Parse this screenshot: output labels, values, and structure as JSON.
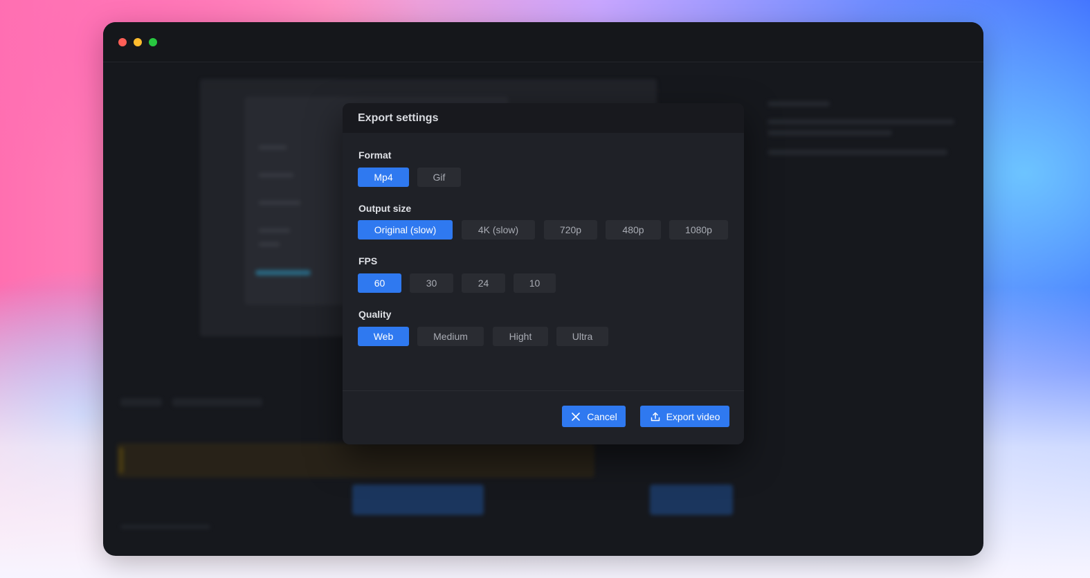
{
  "window": {
    "traffic_lights": [
      "close",
      "minimize",
      "zoom"
    ]
  },
  "dialog": {
    "title": "Export settings",
    "sections": {
      "format": {
        "label": "Format",
        "options": [
          "Mp4",
          "Gif"
        ],
        "selected": "Mp4"
      },
      "output_size": {
        "label": "Output size",
        "options": [
          "Original (slow)",
          "4K (slow)",
          "720p",
          "480p",
          "1080p"
        ],
        "selected": "Original (slow)"
      },
      "fps": {
        "label": "FPS",
        "options": [
          "60",
          "30",
          "24",
          "10"
        ],
        "selected": "60"
      },
      "quality": {
        "label": "Quality",
        "options": [
          "Web",
          "Medium",
          "Hight",
          "Ultra"
        ],
        "selected": "Web"
      }
    },
    "buttons": {
      "cancel": {
        "label": "Cancel",
        "icon": "close-icon"
      },
      "export": {
        "label": "Export video",
        "icon": "upload-icon"
      }
    }
  },
  "colors": {
    "accent": "#2f79f0",
    "window_bg": "#16181d",
    "dialog_bg": "#1f2127",
    "option_bg": "#2a2c32"
  }
}
